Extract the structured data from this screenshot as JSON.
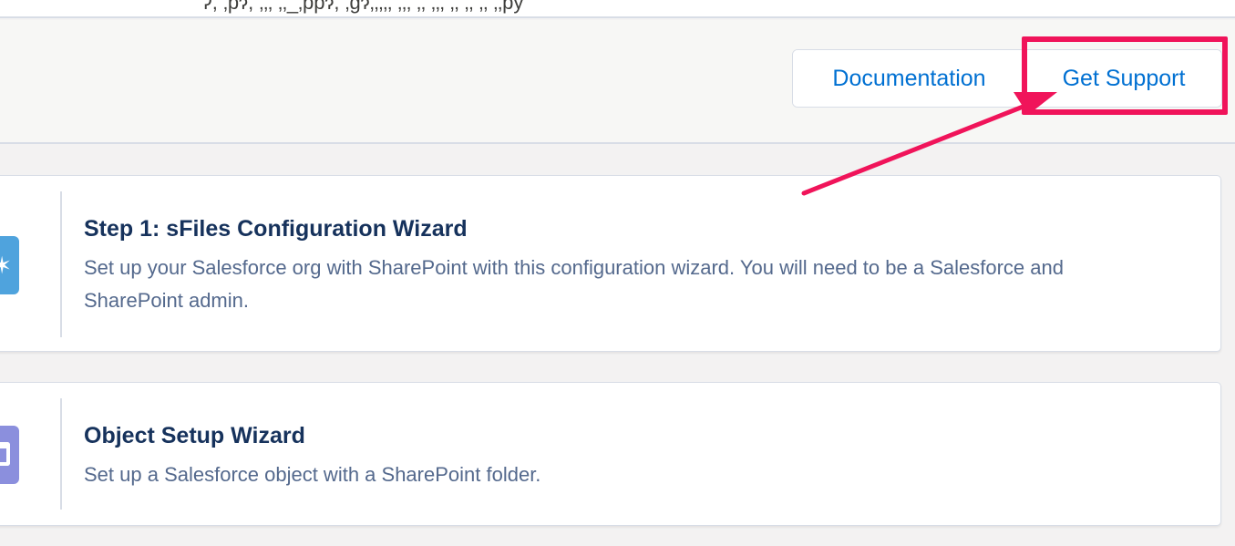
{
  "top_strip": {
    "partial_text": "Ɂ, ‚pɂ, ‚‚‚ ‚‚_‚ppɂ, ‚gɂ‚‚‚‚‚ ‚‚‚ ‚‚ ‚‚‚ ‚‚ ‚‚ ‚‚ ‚‚py"
  },
  "header": {
    "documentation_label": "Documentation",
    "support_label": "Get Support"
  },
  "annotation": {
    "highlight_color": "#f0145a"
  },
  "cards": [
    {
      "title": "Step 1: sFiles Configuration Wizard",
      "description": "Set up your Salesforce org with SharePoint with this configuration wizard. You will need to be a Salesforce and SharePoint admin.",
      "icon": "wizard-sparkle-icon",
      "icon_color": "#4fa3dd"
    },
    {
      "title": "Object Setup Wizard",
      "description": "Set up a Salesforce object with a SharePoint folder.",
      "icon": "window-icon",
      "icon_color": "#8b8fdd"
    }
  ]
}
